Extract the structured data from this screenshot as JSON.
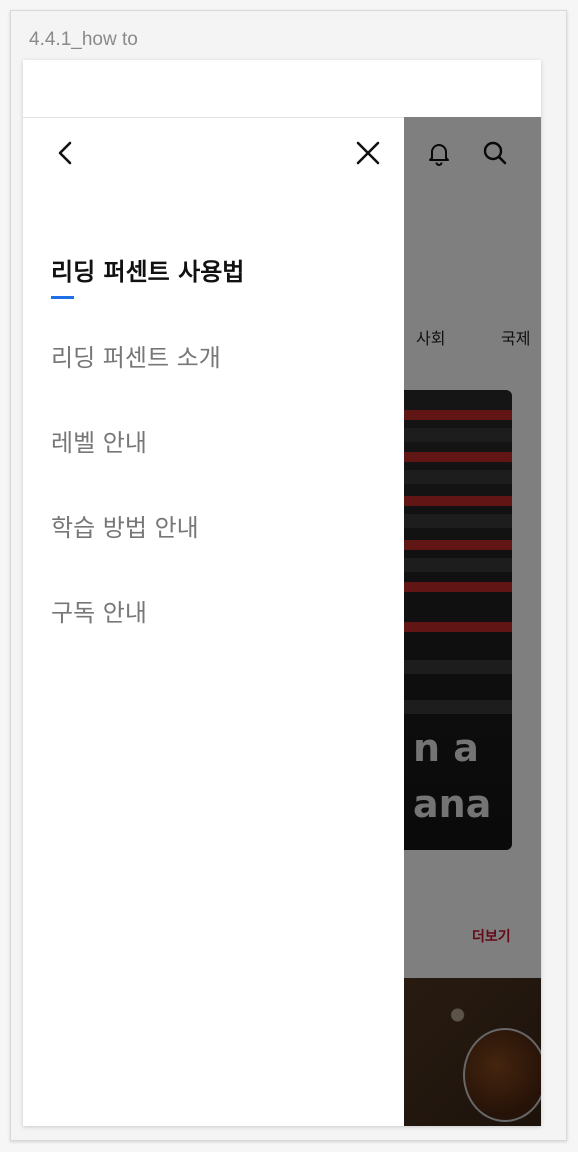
{
  "frame": {
    "title": "4.4.1_how to"
  },
  "drawer": {
    "heading": "리딩 퍼센트 사용법",
    "items": [
      {
        "label": "리딩 퍼센트 소개"
      },
      {
        "label": "레벨 안내"
      },
      {
        "label": "학습 방법 안내"
      },
      {
        "label": "구독 안내"
      }
    ],
    "back_icon": "chevron-left-icon",
    "close_icon": "close-icon",
    "accent_color": "#1e6fe8"
  },
  "background": {
    "header_icons": [
      "bell-icon",
      "search-icon"
    ],
    "categories": [
      "사회",
      "국제"
    ],
    "hero_text_line1": "n a",
    "hero_text_line2": "ana",
    "more_label": "더보기",
    "more_color": "#c8102e"
  }
}
